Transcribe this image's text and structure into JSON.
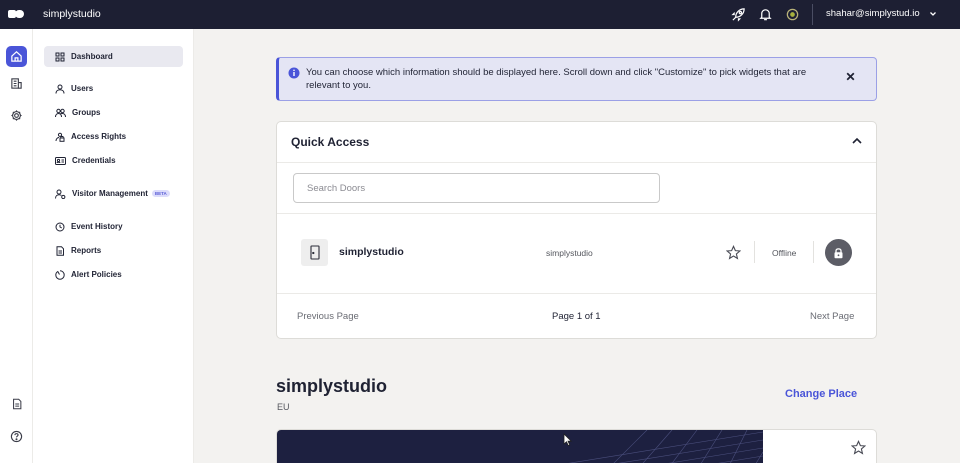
{
  "app": {
    "name": "simplystudio"
  },
  "header": {
    "user_email": "shahar@simplystud.io",
    "icons": [
      "rocket-icon",
      "bell-icon",
      "status-indicator-icon",
      "chevron-down-icon"
    ]
  },
  "rail": {
    "icons": [
      "home-icon",
      "building-icon",
      "gear-icon",
      "document-icon",
      "help-icon"
    ]
  },
  "sidebar": {
    "items": [
      {
        "label": "Dashboard",
        "icon": "grid-icon",
        "active": true
      },
      {
        "label": "Users",
        "icon": "user-icon"
      },
      {
        "label": "Groups",
        "icon": "group-icon"
      },
      {
        "label": "Access Rights",
        "icon": "lock-group-icon"
      },
      {
        "label": "Credentials",
        "icon": "id-card-icon"
      },
      {
        "label": "Visitor Management",
        "icon": "visitor-icon",
        "badge": "BETA"
      },
      {
        "label": "Event History",
        "icon": "clock-icon"
      },
      {
        "label": "Reports",
        "icon": "report-icon"
      },
      {
        "label": "Alert Policies",
        "icon": "alert-icon"
      }
    ]
  },
  "banner": {
    "text": "You can choose which information should be displayed here. Scroll down and click \"Customize\" to pick widgets that are relevant to you."
  },
  "quick_access": {
    "title": "Quick Access",
    "search_placeholder": "Search Doors",
    "doors": [
      {
        "name": "simplystudio",
        "place": "simplystudio",
        "status": "Offline"
      }
    ],
    "pagination": {
      "previous": "Previous Page",
      "page_info": "Page 1 of 1",
      "next": "Next Page"
    }
  },
  "place": {
    "title": "simplystudio",
    "region": "EU",
    "change_label": "Change Place"
  },
  "colors": {
    "topbar": "#1d1f33",
    "accent": "#4a55d8",
    "banner_bg": "#e4e5f4"
  }
}
